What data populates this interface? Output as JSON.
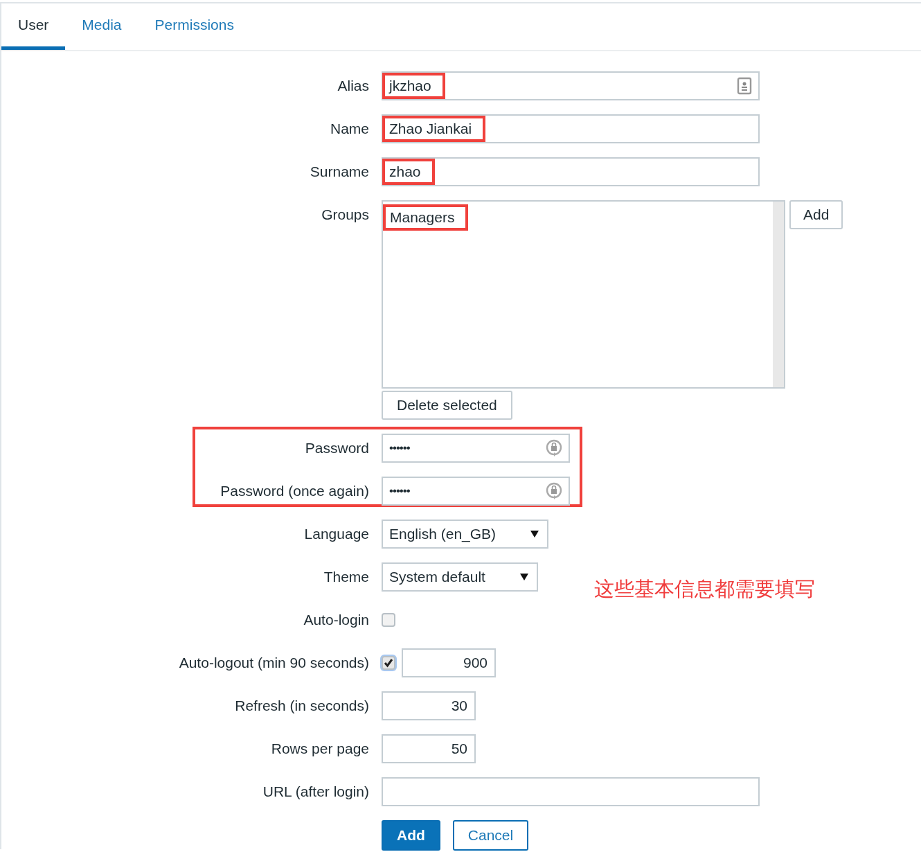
{
  "tabs": [
    {
      "label": "User",
      "selected": true
    },
    {
      "label": "Media",
      "selected": false
    },
    {
      "label": "Permissions",
      "selected": false
    }
  ],
  "form": {
    "rows": [
      {
        "kind": "text",
        "label": "Alias",
        "value": "jkzhao",
        "highlighted": true,
        "icon": true
      },
      {
        "kind": "text",
        "label": "Name",
        "value": "Zhao Jiankai",
        "highlighted": true
      },
      {
        "kind": "text",
        "label": "Surname",
        "value": "zhao",
        "highlighted": true
      },
      {
        "kind": "multiselect",
        "label": "Groups",
        "items": [
          {
            "label": "Managers",
            "highlighted": true
          }
        ],
        "add_button": "Add",
        "delete_button": "Delete selected"
      },
      {
        "kind": "group",
        "highlighted": true,
        "rows": [
          {
            "kind": "password",
            "label": "Password",
            "value": "••••••",
            "icon": true
          },
          {
            "kind": "password",
            "label": "Password (once again)",
            "value": "••••••",
            "icon": true
          }
        ]
      },
      {
        "kind": "select",
        "label": "Language",
        "value": "English (en_GB)"
      },
      {
        "kind": "select",
        "label": "Theme",
        "value": "System default"
      },
      {
        "kind": "checkbox",
        "label": "Auto-login",
        "checked": false
      },
      {
        "kind": "checkbox_number",
        "label": "Auto-logout (min 90 seconds)",
        "checked": true,
        "value": "900"
      },
      {
        "kind": "number",
        "label": "Refresh (in seconds)",
        "value": "30"
      },
      {
        "kind": "number",
        "label": "Rows per page",
        "value": "50"
      },
      {
        "kind": "text",
        "label": "URL (after login)"
      }
    ],
    "actions": [
      {
        "label": "Add",
        "primary": true
      },
      {
        "label": "Cancel",
        "primary": false
      }
    ]
  },
  "note": "这些基本信息都需要填写"
}
